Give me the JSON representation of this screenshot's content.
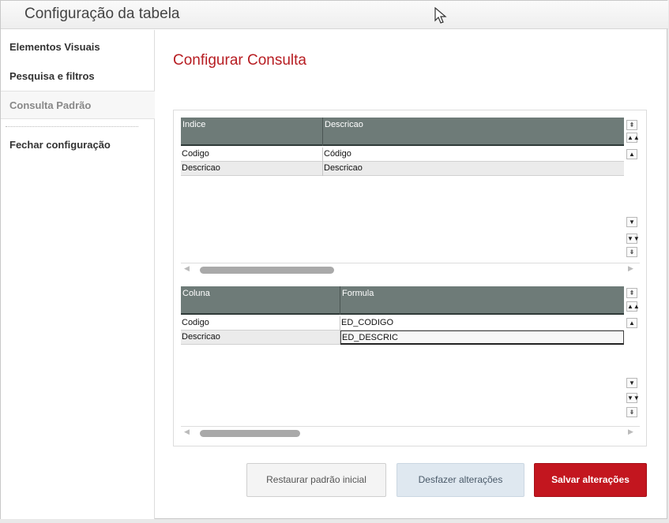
{
  "window": {
    "title": "Configuração da tabela"
  },
  "sidebar": {
    "items": [
      {
        "label": "Elementos Visuais"
      },
      {
        "label": "Pesquisa e filtros"
      },
      {
        "label": "Consulta Padrão"
      },
      {
        "label": "Fechar configuração"
      }
    ]
  },
  "main": {
    "heading": "Configurar Consulta"
  },
  "index_grid": {
    "columns": [
      "Indice",
      "Descricao"
    ],
    "rows": [
      [
        "Codigo",
        "Código"
      ],
      [
        "Descricao",
        "Descricao"
      ]
    ]
  },
  "formula_grid": {
    "columns": [
      "Coluna",
      "Formula"
    ],
    "rows": [
      [
        "Codigo",
        "ED_CODIGO"
      ],
      [
        "Descricao",
        "ED_DESCRIC"
      ]
    ]
  },
  "actions": {
    "restore": "Restaurar padrão inicial",
    "undo": "Desfazer alterações",
    "save": "Salvar alterações"
  },
  "scroll_icons": {
    "top": "⇞",
    "page_up": "▲▲",
    "up": "▲",
    "down": "▼",
    "page_down": "▼▼",
    "bottom": "⇟",
    "left": "◀",
    "right": "▶"
  }
}
